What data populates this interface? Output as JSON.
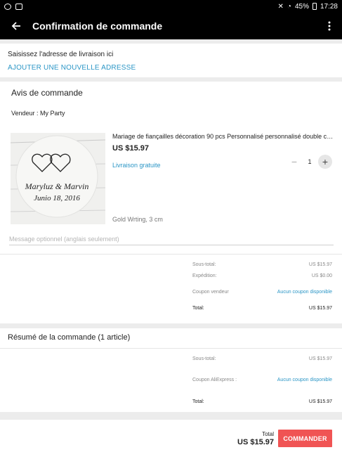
{
  "status_bar": {
    "battery": "45%",
    "time": "17:28"
  },
  "header": {
    "title": "Confirmation de commande"
  },
  "address": {
    "hint": "Saisissez l'adresse de livraison ici",
    "add_link": "AJOUTER UNE NOUVELLE ADRESSE"
  },
  "order": {
    "heading": "Avis de commande",
    "vendor": "Vendeur : My Party",
    "item": {
      "name": "Mariage de fiançailles décoration 90 pcs Personnalisé personnalisé double co...",
      "price": "US $15.97",
      "shipping": "Livraison gratuite",
      "quantity": "1",
      "variant": "Gold Wrting, 3 cm",
      "image_text_line1": "Maryluz & Marvin",
      "image_text_line2": "Junio 18, 2016"
    },
    "message_placeholder": "Message optionnel (anglais seulement)",
    "totals": [
      {
        "label": "Sous-total:",
        "value": "US $15.97"
      },
      {
        "label": "Expédition:",
        "value": "US $0.00"
      },
      {
        "label": "Coupon vendeur",
        "value": "Aucun coupon disponible"
      },
      {
        "label": "Total:",
        "value": "US $15.97"
      }
    ]
  },
  "summary": {
    "heading": "Résumé de la commande (1 article)",
    "rows": [
      {
        "label": "Sous-total:",
        "value": "US $15.97"
      },
      {
        "label": "Coupon AliExpress :",
        "value": "Aucun coupon disponible"
      },
      {
        "label": "Total:",
        "value": "US $15.97"
      }
    ]
  },
  "footer": {
    "total_label": "Total",
    "total_value": "US $15.97",
    "order_button": "COMMANDER"
  },
  "colors": {
    "accent_link": "#2b96c6",
    "cta": "#f05454",
    "header_bg": "#000000"
  }
}
